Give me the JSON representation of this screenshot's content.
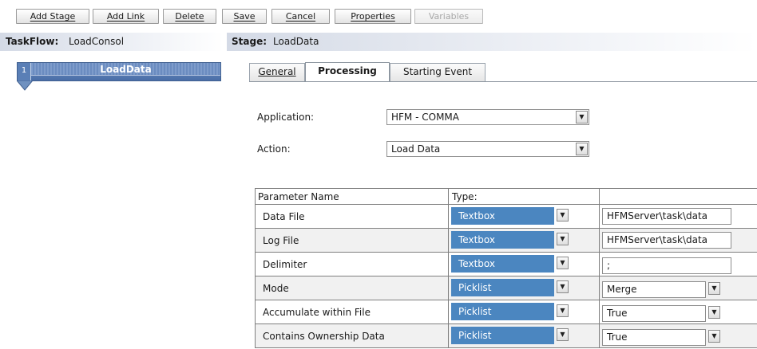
{
  "toolbar": {
    "buttons": [
      "Add Stage",
      "Add Link",
      "Delete",
      "Save",
      "Cancel",
      "Properties",
      "Variables"
    ]
  },
  "taskflow": {
    "label": "TaskFlow:",
    "name": "LoadConsol"
  },
  "stage": {
    "label": "Stage:",
    "name": "LoadData"
  },
  "stage_node": {
    "number": "1",
    "name": "LoadData"
  },
  "tabs": [
    "General",
    "Processing",
    "Starting Event"
  ],
  "active_tab": "Processing",
  "form": {
    "application_label": "Application:",
    "application_value": "HFM - COMMA",
    "action_label": "Action:",
    "action_value": "Load Data"
  },
  "parameters": {
    "headers": [
      "Parameter Name",
      "Type:",
      ""
    ],
    "rows": [
      {
        "name": "Data File",
        "type": "Textbox",
        "value": "HFMServer\\task\\data"
      },
      {
        "name": "Log File",
        "type": "Textbox",
        "value": "HFMServer\\task\\data"
      },
      {
        "name": "Delimiter",
        "type": "Textbox",
        "value": ";"
      },
      {
        "name": "Mode",
        "type": "Picklist",
        "value": "Merge"
      },
      {
        "name": "Accumulate within File",
        "type": "Picklist",
        "value": "True"
      },
      {
        "name": "Contains Ownership Data",
        "type": "Picklist",
        "value": "True"
      }
    ]
  },
  "colors": {
    "accent": "#4b86c0",
    "stage_node": "#5a7fb6",
    "row_alt": "#f1f1f1"
  },
  "icons": {
    "dropdown": "chevron-down-icon"
  }
}
